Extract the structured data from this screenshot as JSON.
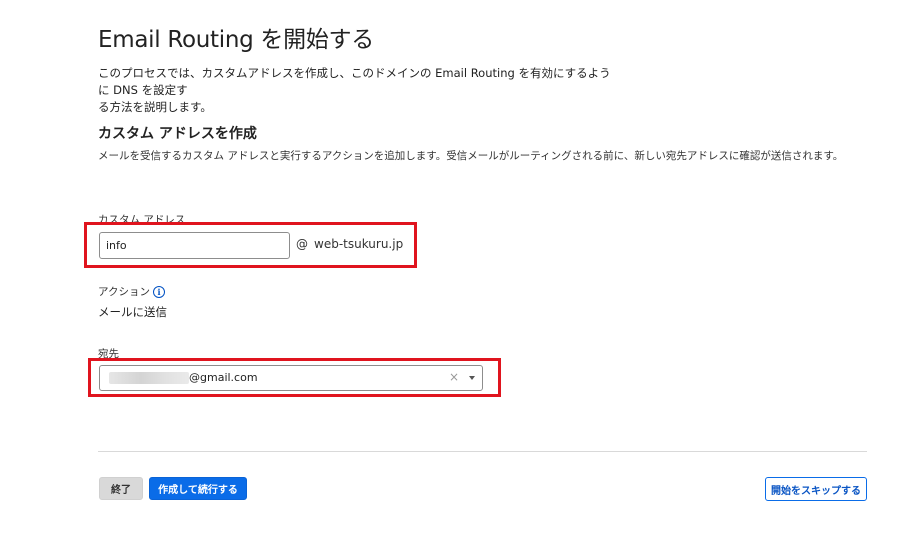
{
  "page": {
    "title": "Email Routing を開始する",
    "intro_line1": "このプロセスでは、カスタムアドレスを作成し、このドメインの Email Routing を有効にするように DNS を設定す",
    "intro_line2": "る方法を説明します。"
  },
  "section": {
    "title": "カスタム アドレスを作成",
    "description": "メールを受信するカスタム アドレスと実行するアクションを追加します。受信メールがルーティングされる前に、新しい宛先アドレスに確認が送信されます。"
  },
  "custom_address": {
    "label": "カスタム アドレス",
    "value": "info",
    "at": "@",
    "domain": "web-tsukuru.jp"
  },
  "action": {
    "label": "アクション",
    "info_icon": "info-icon",
    "value": "メールに送信"
  },
  "destination": {
    "label": "宛先",
    "value": "@gmail.com",
    "clear_symbol": "×",
    "dropdown_icon": "chevron-down-icon"
  },
  "footer": {
    "end_label": "終了",
    "create_continue_label": "作成して続行する",
    "skip_label": "開始をスキップする"
  },
  "colors": {
    "highlight": "#e0141e",
    "primary": "#0a6ce8",
    "link": "#0a55c4"
  }
}
